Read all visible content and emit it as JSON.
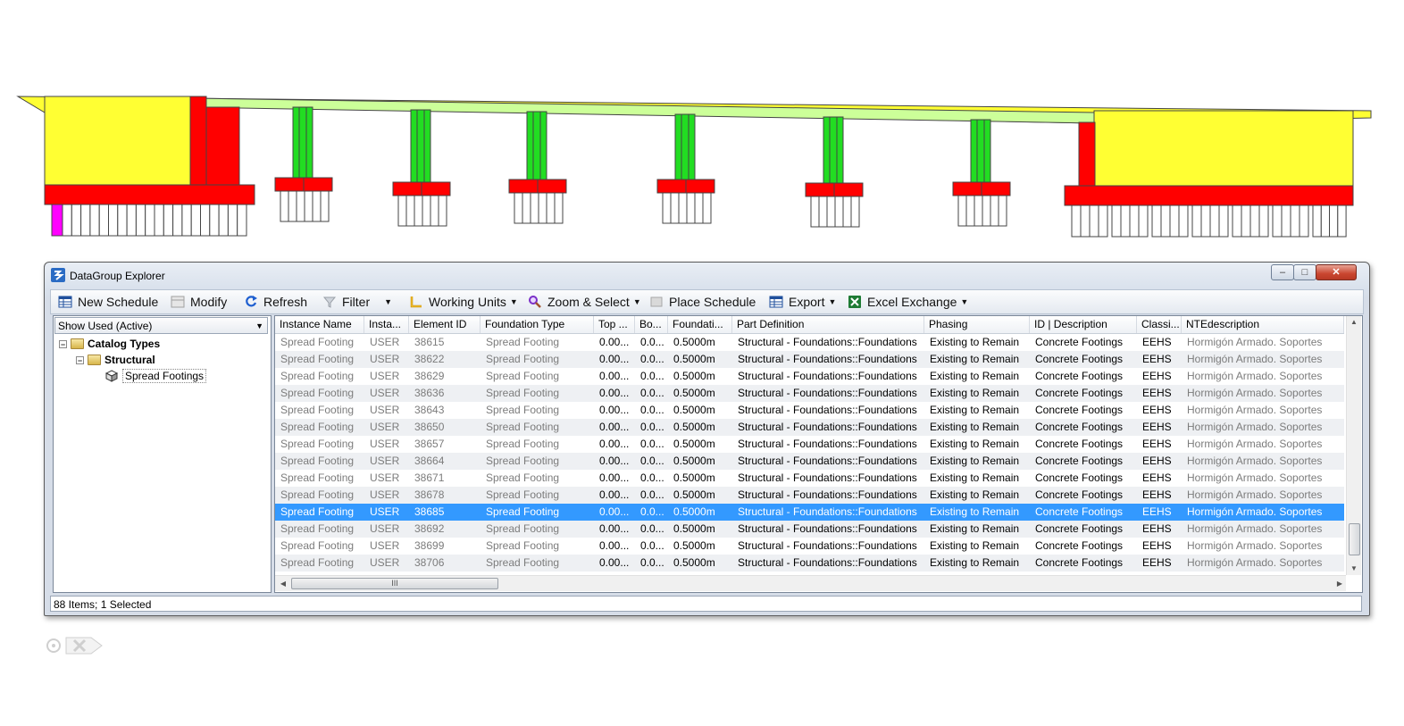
{
  "window": {
    "title": "DataGroup Explorer",
    "controls": {
      "minimize": "–",
      "maximize": "□",
      "close": "✕"
    }
  },
  "toolbar": {
    "new_schedule": "New Schedule",
    "modify": "Modify",
    "refresh": "Refresh",
    "filter": "Filter",
    "working_units": "Working Units",
    "zoom_select": "Zoom & Select",
    "place_schedule": "Place Schedule",
    "export": "Export",
    "excel_exchange": "Excel Exchange"
  },
  "left_pane": {
    "dropdown_value": "Show Used (Active)",
    "tree": {
      "catalog_types": "Catalog Types",
      "structural": "Structural",
      "spread_footings": "Spread Footings"
    }
  },
  "grid": {
    "columns": [
      "Instance Name",
      "Insta...",
      "Element ID",
      "Foundation Type",
      "Top ...",
      "Bo...",
      "Foundati...",
      "Part Definition",
      "Phasing",
      "ID | Description",
      "Classi...",
      "NTEdescription"
    ],
    "selected_index": 10,
    "rows": [
      [
        "Spread Footing",
        "USER",
        "38615",
        "Spread Footing",
        "0.00...",
        "0.0...",
        "0.5000m",
        "Structural - Foundations::Foundations",
        "Existing to Remain",
        "Concrete Footings",
        "EEHS",
        "Hormigón Armado. Soportes"
      ],
      [
        "Spread Footing",
        "USER",
        "38622",
        "Spread Footing",
        "0.00...",
        "0.0...",
        "0.5000m",
        "Structural - Foundations::Foundations",
        "Existing to Remain",
        "Concrete Footings",
        "EEHS",
        "Hormigón Armado. Soportes"
      ],
      [
        "Spread Footing",
        "USER",
        "38629",
        "Spread Footing",
        "0.00...",
        "0.0...",
        "0.5000m",
        "Structural - Foundations::Foundations",
        "Existing to Remain",
        "Concrete Footings",
        "EEHS",
        "Hormigón Armado. Soportes"
      ],
      [
        "Spread Footing",
        "USER",
        "38636",
        "Spread Footing",
        "0.00...",
        "0.0...",
        "0.5000m",
        "Structural - Foundations::Foundations",
        "Existing to Remain",
        "Concrete Footings",
        "EEHS",
        "Hormigón Armado. Soportes"
      ],
      [
        "Spread Footing",
        "USER",
        "38643",
        "Spread Footing",
        "0.00...",
        "0.0...",
        "0.5000m",
        "Structural - Foundations::Foundations",
        "Existing to Remain",
        "Concrete Footings",
        "EEHS",
        "Hormigón Armado. Soportes"
      ],
      [
        "Spread Footing",
        "USER",
        "38650",
        "Spread Footing",
        "0.00...",
        "0.0...",
        "0.5000m",
        "Structural - Foundations::Foundations",
        "Existing to Remain",
        "Concrete Footings",
        "EEHS",
        "Hormigón Armado. Soportes"
      ],
      [
        "Spread Footing",
        "USER",
        "38657",
        "Spread Footing",
        "0.00...",
        "0.0...",
        "0.5000m",
        "Structural - Foundations::Foundations",
        "Existing to Remain",
        "Concrete Footings",
        "EEHS",
        "Hormigón Armado. Soportes"
      ],
      [
        "Spread Footing",
        "USER",
        "38664",
        "Spread Footing",
        "0.00...",
        "0.0...",
        "0.5000m",
        "Structural - Foundations::Foundations",
        "Existing to Remain",
        "Concrete Footings",
        "EEHS",
        "Hormigón Armado. Soportes"
      ],
      [
        "Spread Footing",
        "USER",
        "38671",
        "Spread Footing",
        "0.00...",
        "0.0...",
        "0.5000m",
        "Structural - Foundations::Foundations",
        "Existing to Remain",
        "Concrete Footings",
        "EEHS",
        "Hormigón Armado. Soportes"
      ],
      [
        "Spread Footing",
        "USER",
        "38678",
        "Spread Footing",
        "0.00...",
        "0.0...",
        "0.5000m",
        "Structural - Foundations::Foundations",
        "Existing to Remain",
        "Concrete Footings",
        "EEHS",
        "Hormigón Armado. Soportes"
      ],
      [
        "Spread Footing",
        "USER",
        "38685",
        "Spread Footing",
        "0.00...",
        "0.0...",
        "0.5000m",
        "Structural - Foundations::Foundations",
        "Existing to Remain",
        "Concrete Footings",
        "EEHS",
        "Hormigón Armado. Soportes"
      ],
      [
        "Spread Footing",
        "USER",
        "38692",
        "Spread Footing",
        "0.00...",
        "0.0...",
        "0.5000m",
        "Structural - Foundations::Foundations",
        "Existing to Remain",
        "Concrete Footings",
        "EEHS",
        "Hormigón Armado. Soportes"
      ],
      [
        "Spread Footing",
        "USER",
        "38699",
        "Spread Footing",
        "0.00...",
        "0.0...",
        "0.5000m",
        "Structural - Foundations::Foundations",
        "Existing to Remain",
        "Concrete Footings",
        "EEHS",
        "Hormigón Armado. Soportes"
      ],
      [
        "Spread Footing",
        "USER",
        "38706",
        "Spread Footing",
        "0.00...",
        "0.0...",
        "0.5000m",
        "Structural - Foundations::Foundations",
        "Existing to Remain",
        "Concrete Footings",
        "EEHS",
        "Hormigón Armado. Soportes"
      ]
    ],
    "hscroll_grip": "III"
  },
  "status_bar": {
    "text": "88 Items; 1 Selected"
  },
  "colors": {
    "abutment": "#ffff33",
    "footing": "#ff0000",
    "pier": "#22dd22",
    "deck": "#ccff99",
    "selection": "#3399ff"
  }
}
